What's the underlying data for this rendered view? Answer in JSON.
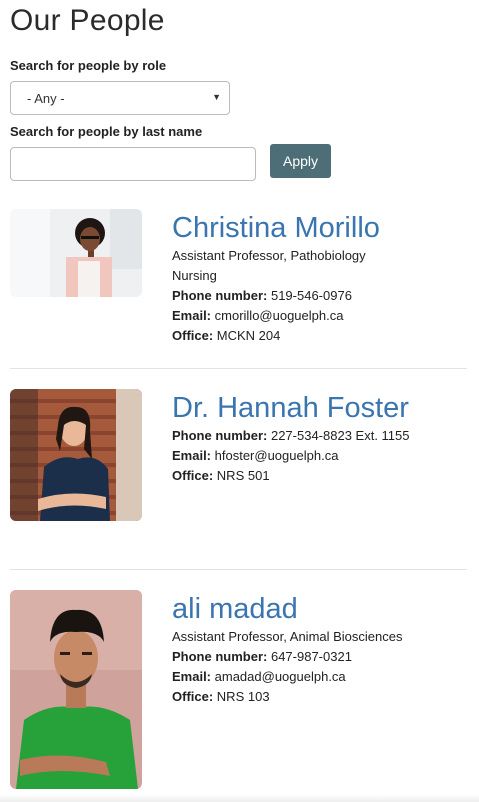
{
  "title": "Our People",
  "search": {
    "role_label": "Search for people by role",
    "role_value": "- Any -",
    "name_label": "Search for people by last name",
    "name_value": "",
    "apply_label": "Apply"
  },
  "people": [
    {
      "name": "Christina Morillo",
      "title": "Assistant Professor, Pathobiology",
      "department": "Nursing",
      "phone_label": "Phone number:",
      "phone": "519-546-0976",
      "email_label": "Email:",
      "email": "cmorillo@uoguelph.ca",
      "office_label": "Office:",
      "office": "MCKN 204"
    },
    {
      "name": "Dr. Hannah Foster",
      "phone_label": "Phone number:",
      "phone": "227-534-8823 Ext. 1155",
      "email_label": "Email:",
      "email": "hfoster@uoguelph.ca",
      "office_label": "Office:",
      "office": "NRS 501"
    },
    {
      "name": "ali madad",
      "title": "Assistant Professor, Animal Biosciences",
      "phone_label": "Phone number:",
      "phone": "647-987-0321",
      "email_label": "Email:",
      "email": "amadad@uoguelph.ca",
      "office_label": "Office:",
      "office": "NRS 103"
    }
  ]
}
